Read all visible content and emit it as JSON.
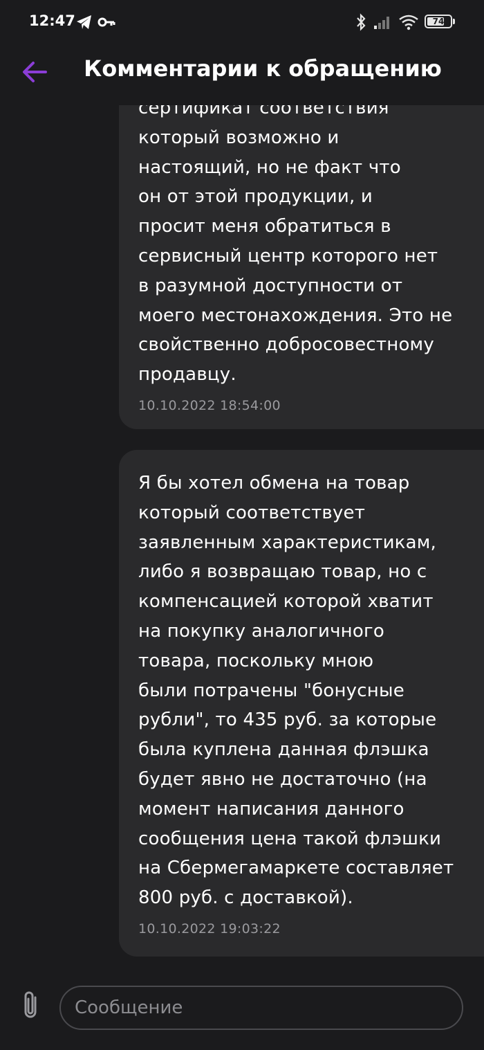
{
  "status_bar": {
    "time": "12:47",
    "battery": "74",
    "icons": [
      "telegram-icon",
      "key-icon",
      "bluetooth-icon",
      "signal-icon",
      "wifi-icon",
      "battery-icon"
    ]
  },
  "header": {
    "title": "Комментарии к обращению",
    "back_icon": "arrow-left-icon",
    "accent_color": "#8b3dd6"
  },
  "messages": [
    {
      "text": "сертификат соответствия\nкоторый возможно и\nнастоящий, но не факт что\nон от этой продукции, и\nпросит меня обратиться в\nсервисный центр которого нет\nв разумной доступности от\nмоего местонахождения. Это не\nсвойственно добросовестному\nпродавцу.",
      "time": "10.10.2022 18:54:00"
    },
    {
      "text": "Я бы хотел обмена на товар\nкоторый соответствует\nзаявленным характеристикам,\nлибо я возвращаю товар, но с\nкомпенсацией которой хватит\nна покупку аналогичного\nтовара, поскольку мною\nбыли потрачены \"бонусные\nрубли\", то 435 руб. за которые\nбыла куплена данная флэшка\nбудет явно не достаточно (на\nмомент написания данного\nсообщения цена такой флэшки\nна Сбермегамаркете составляет\n800 руб. с доставкой).",
      "time": "10.10.2022 19:03:22"
    }
  ],
  "composer": {
    "placeholder": "Сообщение",
    "value": "",
    "attach_icon": "paperclip-icon"
  }
}
